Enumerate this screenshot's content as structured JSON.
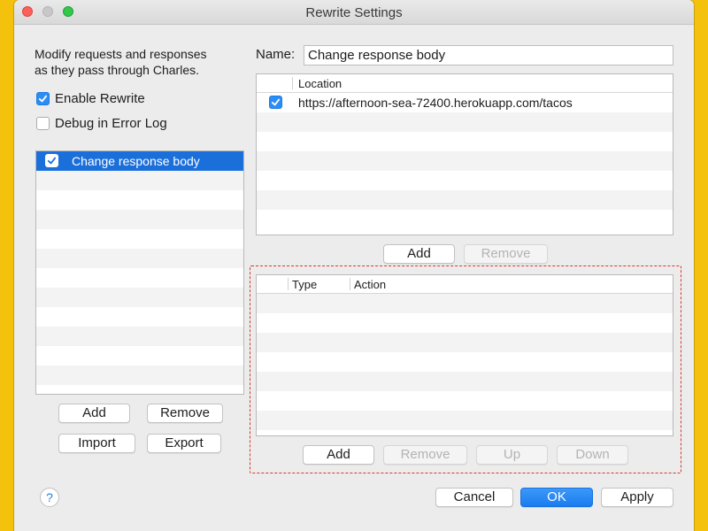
{
  "window": {
    "title": "Rewrite Settings"
  },
  "intro": {
    "line1": "Modify requests and responses",
    "line2": "as they pass through Charles."
  },
  "options": {
    "enable_rewrite": {
      "label": "Enable Rewrite",
      "checked": true
    },
    "debug_error_log": {
      "label": "Debug in Error Log",
      "checked": false
    }
  },
  "rewrite_sets": {
    "items": [
      {
        "label": "Change response body",
        "checked": true
      }
    ],
    "buttons": {
      "add": "Add",
      "remove": "Remove",
      "import": "Import",
      "export": "Export"
    }
  },
  "name_field": {
    "label": "Name:",
    "value": "Change response body"
  },
  "locations": {
    "header": "Location",
    "rows": [
      {
        "checked": true,
        "location": "https://afternoon-sea-72400.herokuapp.com/tacos"
      }
    ],
    "buttons": {
      "add": "Add",
      "remove": "Remove"
    }
  },
  "rules": {
    "headers": {
      "type": "Type",
      "action": "Action"
    },
    "rows": [],
    "buttons": {
      "add": "Add",
      "remove": "Remove",
      "up": "Up",
      "down": "Down"
    }
  },
  "footer": {
    "help": "?",
    "cancel": "Cancel",
    "ok": "OK",
    "apply": "Apply"
  },
  "colors": {
    "background": "#F4C20D",
    "accent": "#1B6FDB",
    "highlight_frame": "#D23A2E"
  }
}
